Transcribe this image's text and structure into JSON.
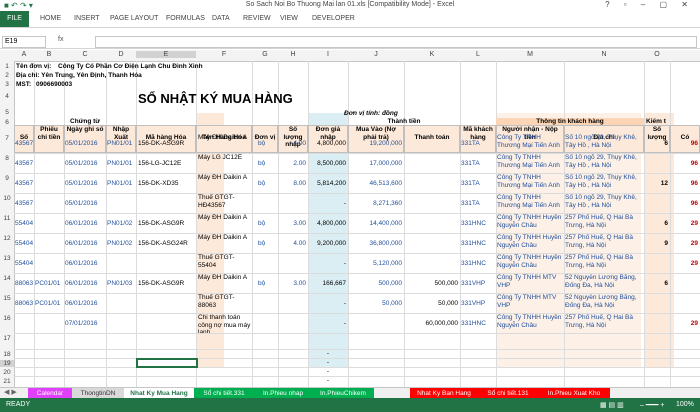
{
  "window": {
    "title": "So Sach Noi Bo Thuong Mai lan 01.xls  [Compatibility Mode] - Excel"
  },
  "ribbon": {
    "file": "FILE",
    "tabs": [
      "HOME",
      "INSERT",
      "PAGE LAYOUT",
      "FORMULAS",
      "DATA",
      "REVIEW",
      "VIEW",
      "DEVELOPER"
    ]
  },
  "formula_bar": {
    "name_box": "E19",
    "fx": "fx",
    "value": ""
  },
  "columns": [
    "A",
    "B",
    "C",
    "D",
    "E",
    "F",
    "G",
    "H",
    "I",
    "J",
    "K",
    "L",
    "M",
    "N",
    "O"
  ],
  "rows": [
    "1",
    "2",
    "3",
    "4",
    "5",
    "6",
    "7",
    "8",
    "9",
    "10",
    "11",
    "12",
    "13",
    "14",
    "15",
    "16",
    "17",
    "18",
    "19",
    "20",
    "21",
    "22"
  ],
  "company": {
    "name_label": "Tên đơn vị:",
    "name_value": "Công Ty Cổ Phần Cơ Điện Lạnh Chu Đình Xinh",
    "address": "Địa chỉ: Yên Trung, Yên Định, Thanh Hóa",
    "tax_label": "MST:",
    "tax_value": "0906690003"
  },
  "sheet_title": "SỔ NHẬT KÝ MUA HÀNG",
  "unit_note": "Đơn vị tính: đồng",
  "group_headers": {
    "chung_tu": "Chứng từ",
    "thanh_tien": "Thành tiền",
    "thong_tin_kh": "Thông tin khách hàng",
    "kiem_tra": "Kiểm t"
  },
  "headers": {
    "so": "Số",
    "phieu_chi": "Phiếu chi tiền",
    "ngay_ghi_so": "Ngày ghi sổ",
    "nhap_xuat": "Nhập Xuất",
    "ma_hang": "Mã hàng Hóa",
    "ten_hang": "Tên Hàng Hóa",
    "dvt": "Đơn vị",
    "so_luong": "Số lượng nhập",
    "don_gia": "Đơn giá nhập",
    "mua_vao": "Mua Vào (Nợ phải trả)",
    "thanh_toan": "Thanh toán",
    "ma_kh": "Mã khách hàng",
    "nguoi_nhan": "Người nhận - Nộp tiền",
    "dia_chi": "Địa chỉ",
    "so_luong2": "Số lượng",
    "co": "Có"
  },
  "data_rows": [
    {
      "row": "8",
      "so": "43567",
      "phieu": "",
      "ngay": "05/01/2016",
      "nx": "PN01/01",
      "ma": "156-DK-ASG9R",
      "ten": "Máy ĐH Daikin A",
      "dvt": "bộ",
      "sl": "4.00",
      "gia": "4,800,000",
      "mua": "19,200,000",
      "tt": "",
      "makh": "331TA",
      "nguoi": "Công Ty TNHH Thương Mại Tiến Anh",
      "dc": "Số 10 ngõ 29, Thụy Khê, Tây Hồ , Hà Nội",
      "sl2": "6",
      "co": "96"
    },
    {
      "row": "9",
      "so": "43567",
      "phieu": "",
      "ngay": "05/01/2016",
      "nx": "PN01/01",
      "ma": "156-LG-JC12E",
      "ten": "Máy LG JC12E",
      "dvt": "bộ",
      "sl": "2.00",
      "gia": "8,500,000",
      "mua": "17,000,000",
      "tt": "",
      "makh": "331TA",
      "nguoi": "Công Ty TNHH Thương Mại Tiến Anh",
      "dc": "Số 10 ngõ 29, Thụy Khê, Tây Hồ , Hà Nội",
      "sl2": "",
      "co": "96"
    },
    {
      "row": "10",
      "so": "43567",
      "phieu": "",
      "ngay": "05/01/2016",
      "nx": "PN01/01",
      "ma": "156-DK-XD35",
      "ten": "Máy ĐH Daikin A",
      "dvt": "bộ",
      "sl": "8.00",
      "gia": "5,814,200",
      "mua": "46,513,600",
      "tt": "",
      "makh": "331TA",
      "nguoi": "Công Ty TNHH Thương Mại Tiến Anh",
      "dc": "Số 10 ngõ 29, Thụy Khê, Tây Hồ , Hà Nội",
      "sl2": "12",
      "co": "96"
    },
    {
      "row": "11",
      "so": "43567",
      "phieu": "",
      "ngay": "05/01/2016",
      "nx": "",
      "ma": "",
      "ten": "Thuế GTGT-HĐ43567",
      "dvt": "",
      "sl": "",
      "gia": "-",
      "mua": "8,271,360",
      "tt": "",
      "makh": "331TA",
      "nguoi": "Công Ty TNHH Thương Mại Tiến Anh",
      "dc": "Số 10 ngõ 29, Thụy Khê, Tây Hồ , Hà Nội",
      "sl2": "",
      "co": "96"
    },
    {
      "row": "12",
      "so": "55404",
      "phieu": "",
      "ngay": "06/01/2016",
      "nx": "PN01/02",
      "ma": "156-DK-ASG9R",
      "ten": "Máy ĐH Daikin A",
      "dvt": "bộ",
      "sl": "3.00",
      "gia": "4,800,000",
      "mua": "14,400,000",
      "tt": "",
      "makh": "331HNC",
      "nguoi": "Công Ty TNHH Huyền Nguyễn Châu",
      "dc": "257 Phố Huế, Q Hai Bà Trưng, Hà Nội",
      "sl2": "6",
      "co": "29"
    },
    {
      "row": "13",
      "so": "55404",
      "phieu": "",
      "ngay": "06/01/2016",
      "nx": "PN01/02",
      "ma": "156-DK-ASG24R",
      "ten": "Máy ĐH Daikin A",
      "dvt": "bộ",
      "sl": "4.00",
      "gia": "9,200,000",
      "mua": "36,800,000",
      "tt": "",
      "makh": "331HNC",
      "nguoi": "Công Ty TNHH Huyền Nguyễn Châu",
      "dc": "257 Phố Huế, Q Hai Bà Trưng, Hà Nội",
      "sl2": "9",
      "co": "29"
    },
    {
      "row": "14",
      "so": "55404",
      "phieu": "",
      "ngay": "06/01/2016",
      "nx": "",
      "ma": "",
      "ten": "Thuế GTGT-55404",
      "dvt": "",
      "sl": "",
      "gia": "-",
      "mua": "5,120,000",
      "tt": "",
      "makh": "331HNC",
      "nguoi": "Công Ty TNHH Huyền Nguyễn Châu",
      "dc": "257 Phố Huế, Q Hai Bà Trưng, Hà Nội",
      "sl2": "",
      "co": "29"
    },
    {
      "row": "15",
      "so": "88063",
      "phieu": "PC01/01",
      "ngay": "06/01/2016",
      "nx": "PN01/03",
      "ma": "156-DK-ASG9R",
      "ten": "Máy ĐH Daikin A",
      "dvt": "bộ",
      "sl": "3.00",
      "gia": "166,667",
      "mua": "500,000",
      "tt": "500,000",
      "makh": "331VHP",
      "nguoi": "Công Ty TNHH MTV VHP",
      "dc": "52 Nguyễn Lương Bằng, Đống Đa, Hà Nội",
      "sl2": "6",
      "co": ""
    },
    {
      "row": "16",
      "so": "88063",
      "phieu": "PC01/01",
      "ngay": "06/01/2016",
      "nx": "",
      "ma": "",
      "ten": "Thuế GTGT-88063",
      "dvt": "",
      "sl": "",
      "gia": "-",
      "mua": "50,000",
      "tt": "50,000",
      "makh": "331VHP",
      "nguoi": "Công Ty TNHH MTV VHP",
      "dc": "52 Nguyễn Lương Bằng, Đống Đa, Hà Nội",
      "sl2": "",
      "co": ""
    },
    {
      "row": "17",
      "so": "",
      "phieu": "",
      "ngay": "07/01/2016",
      "nx": "",
      "ma": "",
      "ten": "Chi thanh toán công nợ mua máy lạnh",
      "dvt": "",
      "sl": "",
      "gia": "-",
      "mua": "",
      "tt": "60,000,000",
      "makh": "331HNC",
      "nguoi": "Công Ty TNHH Huyền Nguyễn Châu",
      "dc": "257 Phố Huế, Q Hai Bà Trưng, Hà Nội",
      "sl2": "",
      "co": "29"
    }
  ],
  "empty_dash": "-",
  "sheet_tabs": [
    {
      "label": "Calendar",
      "color": "#e040fb"
    },
    {
      "label": "ThongtinDN",
      "color": "#d9d9d9"
    },
    {
      "label": "Nhat Ky Mua Hang",
      "color": "#ffffff"
    },
    {
      "label": "Sổ chi tiết.331",
      "color": "#00b050"
    },
    {
      "label": "In.Phieu nhap",
      "color": "#00b050"
    },
    {
      "label": "In.PhieuChikem",
      "color": "#00b050"
    },
    {
      "label": "Nhat Ky Ban Hang",
      "color": "#ff0000"
    },
    {
      "label": "Sổ chi tiết.131",
      "color": "#ff0000"
    },
    {
      "label": "In.Phieu Xuat Kho",
      "color": "#ff0000"
    }
  ],
  "status": {
    "ready": "READY",
    "zoom": "100%"
  }
}
